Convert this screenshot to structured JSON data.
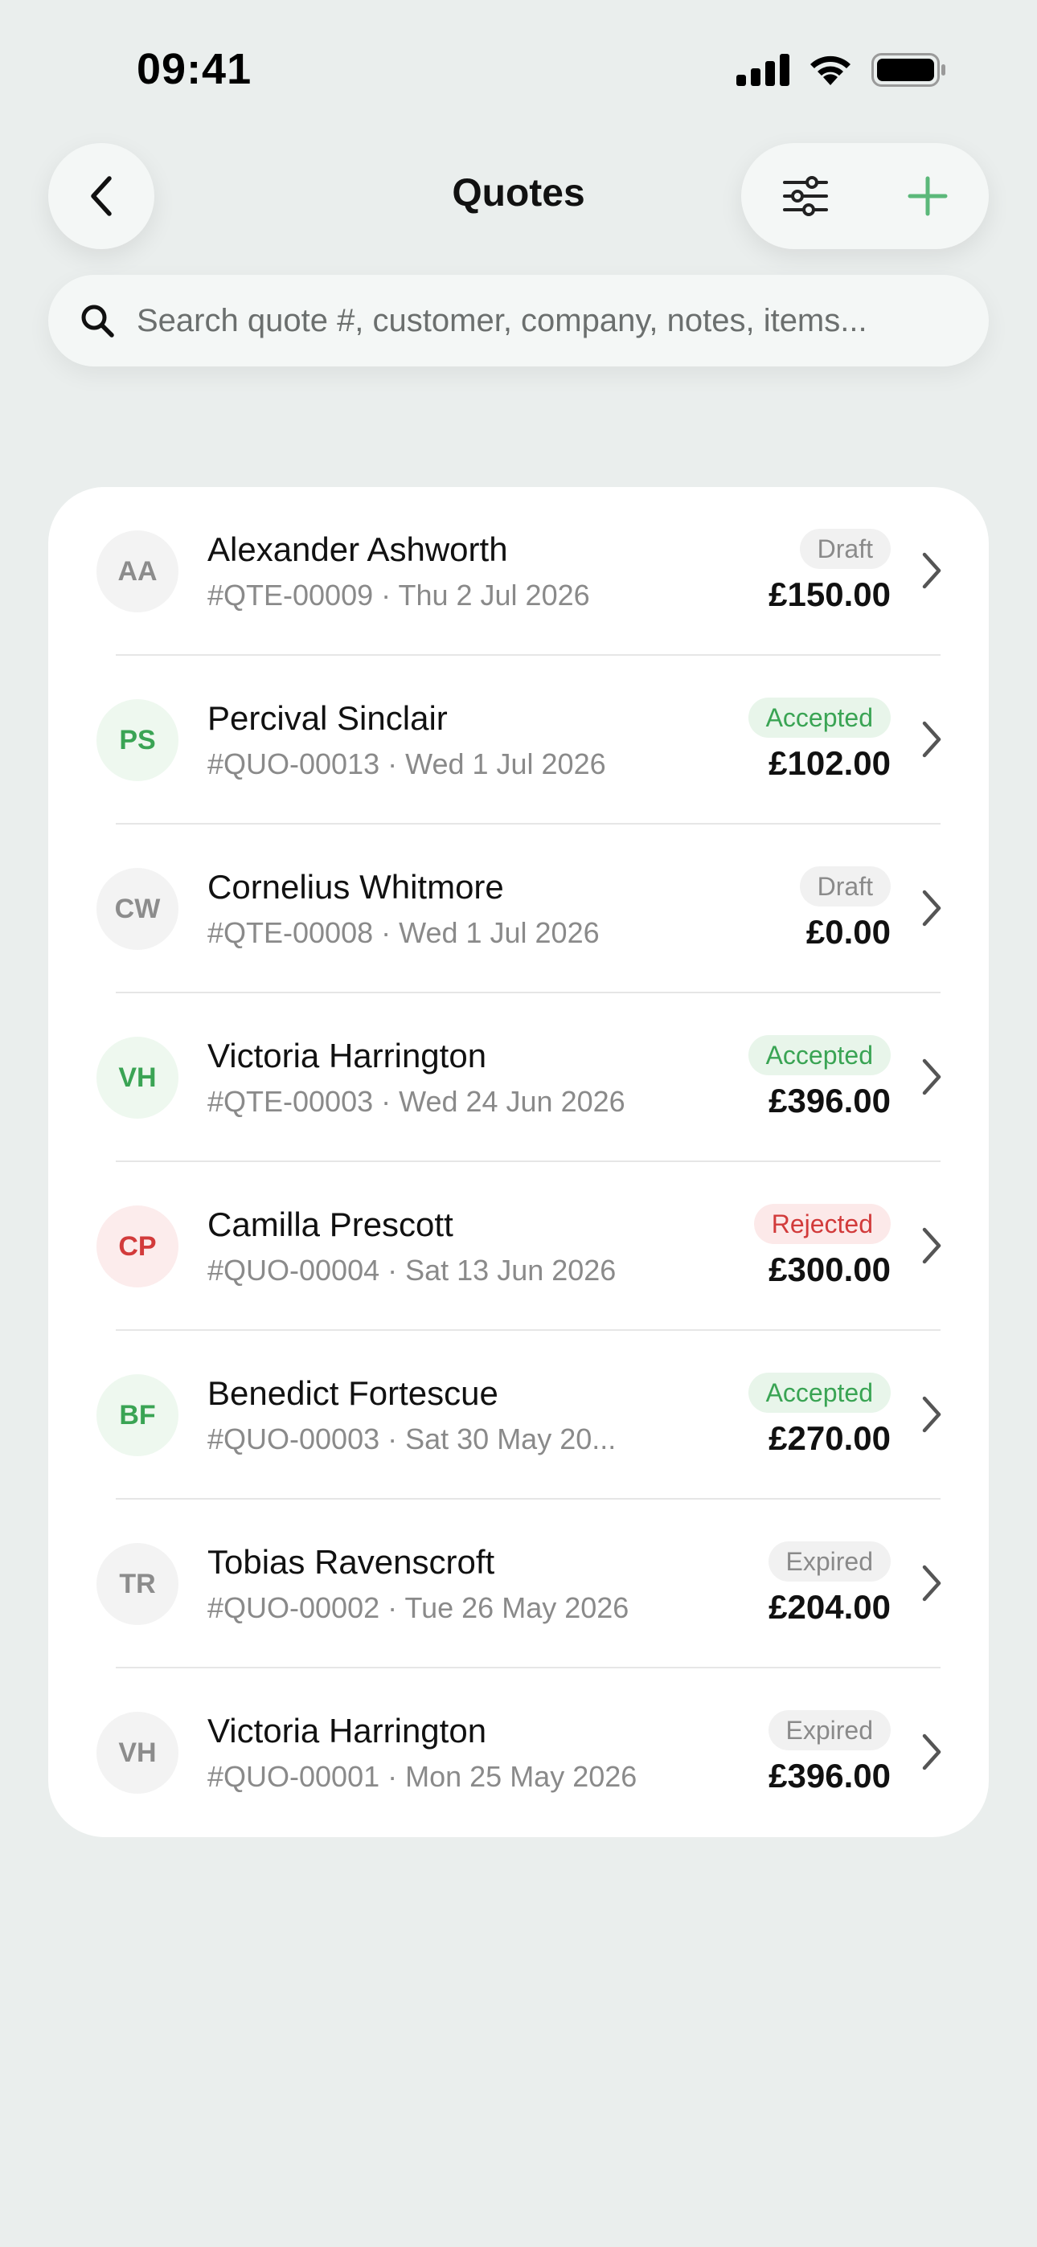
{
  "status_bar": {
    "time": "09:41"
  },
  "header": {
    "title": "Quotes"
  },
  "search": {
    "placeholder": "Search quote #, customer, company, notes, items..."
  },
  "colors": {
    "accent": "#3aa454",
    "rejected": "#d23b3b",
    "background": "#eaeeed",
    "card": "#ffffff"
  },
  "quotes": [
    {
      "initials": "AA",
      "avatar_tone": "neutral",
      "name": "Alexander Ashworth",
      "meta": "#QTE-00009 · Thu 2 Jul 2026",
      "status": "Draft",
      "status_tone": "draft",
      "amount": "£150.00"
    },
    {
      "initials": "PS",
      "avatar_tone": "green",
      "name": "Percival Sinclair",
      "meta": "#QUO-00013 · Wed 1 Jul 2026",
      "status": "Accepted",
      "status_tone": "accepted",
      "amount": "£102.00"
    },
    {
      "initials": "CW",
      "avatar_tone": "neutral",
      "name": "Cornelius Whitmore",
      "meta": "#QTE-00008 · Wed 1 Jul 2026",
      "status": "Draft",
      "status_tone": "draft",
      "amount": "£0.00"
    },
    {
      "initials": "VH",
      "avatar_tone": "green",
      "name": "Victoria Harrington",
      "meta": "#QTE-00003 · Wed 24 Jun 2026",
      "status": "Accepted",
      "status_tone": "accepted",
      "amount": "£396.00"
    },
    {
      "initials": "CP",
      "avatar_tone": "red",
      "name": "Camilla Prescott",
      "meta": "#QUO-00004 · Sat 13 Jun 2026",
      "status": "Rejected",
      "status_tone": "rejected",
      "amount": "£300.00"
    },
    {
      "initials": "BF",
      "avatar_tone": "green",
      "name": "Benedict Fortescue",
      "meta": "#QUO-00003 · Sat 30 May 20...",
      "status": "Accepted",
      "status_tone": "accepted",
      "amount": "£270.00"
    },
    {
      "initials": "TR",
      "avatar_tone": "neutral",
      "name": "Tobias Ravenscroft",
      "meta": "#QUO-00002 · Tue 26 May 2026",
      "status": "Expired",
      "status_tone": "expired",
      "amount": "£204.00"
    },
    {
      "initials": "VH",
      "avatar_tone": "neutral",
      "name": "Victoria Harrington",
      "meta": "#QUO-00001 · Mon 25 May 2026",
      "status": "Expired",
      "status_tone": "expired",
      "amount": "£396.00"
    }
  ]
}
